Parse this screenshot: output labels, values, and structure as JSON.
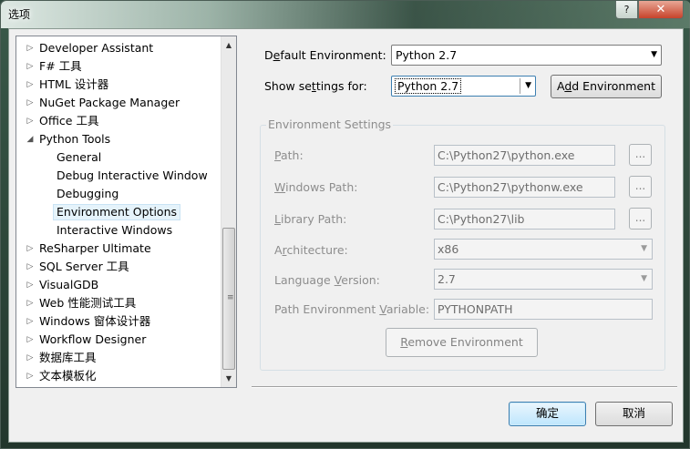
{
  "window": {
    "title": "选项",
    "help_label": "?",
    "close_label": "✕"
  },
  "tree": {
    "items": [
      {
        "label": "Developer Assistant",
        "state": "collapsed"
      },
      {
        "label": "F# 工具",
        "state": "collapsed"
      },
      {
        "label": "HTML 设计器",
        "state": "collapsed"
      },
      {
        "label": "NuGet Package Manager",
        "state": "collapsed"
      },
      {
        "label": "Office 工具",
        "state": "collapsed"
      },
      {
        "label": "Python Tools",
        "state": "expanded"
      },
      {
        "label": "General",
        "state": "child"
      },
      {
        "label": "Debug Interactive Window",
        "state": "child"
      },
      {
        "label": "Debugging",
        "state": "child"
      },
      {
        "label": "Environment Options",
        "state": "child-selected"
      },
      {
        "label": "Interactive Windows",
        "state": "child"
      },
      {
        "label": "ReSharper Ultimate",
        "state": "collapsed"
      },
      {
        "label": "SQL Server 工具",
        "state": "collapsed"
      },
      {
        "label": "VisualGDB",
        "state": "collapsed"
      },
      {
        "label": "Web 性能测试工具",
        "state": "collapsed"
      },
      {
        "label": "Windows 窗体设计器",
        "state": "collapsed"
      },
      {
        "label": "Workflow Designer",
        "state": "collapsed"
      },
      {
        "label": "数据库工具",
        "state": "collapsed"
      },
      {
        "label": "文本模板化",
        "state": "collapsed"
      }
    ]
  },
  "settings": {
    "default_env_label_pre": "D",
    "default_env_label_u": "e",
    "default_env_label_post": "fault Environment:",
    "default_env_value": "Python 2.7",
    "show_for_label_pre": "Show se",
    "show_for_label_u": "t",
    "show_for_label_post": "tings for:",
    "show_for_value": "Python 2.7",
    "add_env_pre": "A",
    "add_env_u": "d",
    "add_env_post": "d Environment"
  },
  "env_settings": {
    "group_title": "Environment Settings",
    "path_label_u": "P",
    "path_label_rest": "ath:",
    "path_value": "C:\\Python27\\python.exe",
    "windows_path_label_u": "W",
    "windows_path_label_rest": "indows Path:",
    "windows_path_value": "C:\\Python27\\pythonw.exe",
    "library_path_label_u": "L",
    "library_path_label_rest": "ibrary Path:",
    "library_path_value": "C:\\Python27\\lib",
    "architecture_label_pre": "A",
    "architecture_label_u": "r",
    "architecture_label_post": "chitecture:",
    "architecture_value": "x86",
    "language_version_label_pre": "Language ",
    "language_version_label_u": "V",
    "language_version_label_post": "ersion:",
    "language_version_value": "2.7",
    "path_env_var_label_pre": "Path Environment ",
    "path_env_var_label_u": "V",
    "path_env_var_label_post": "ariable:",
    "path_env_var_value": "PYTHONPATH",
    "browse_label": "...",
    "remove_env_pre": "",
    "remove_env_u": "R",
    "remove_env_post": "emove Environment"
  },
  "footer": {
    "ok_label": "确定",
    "cancel_label": "取消"
  }
}
